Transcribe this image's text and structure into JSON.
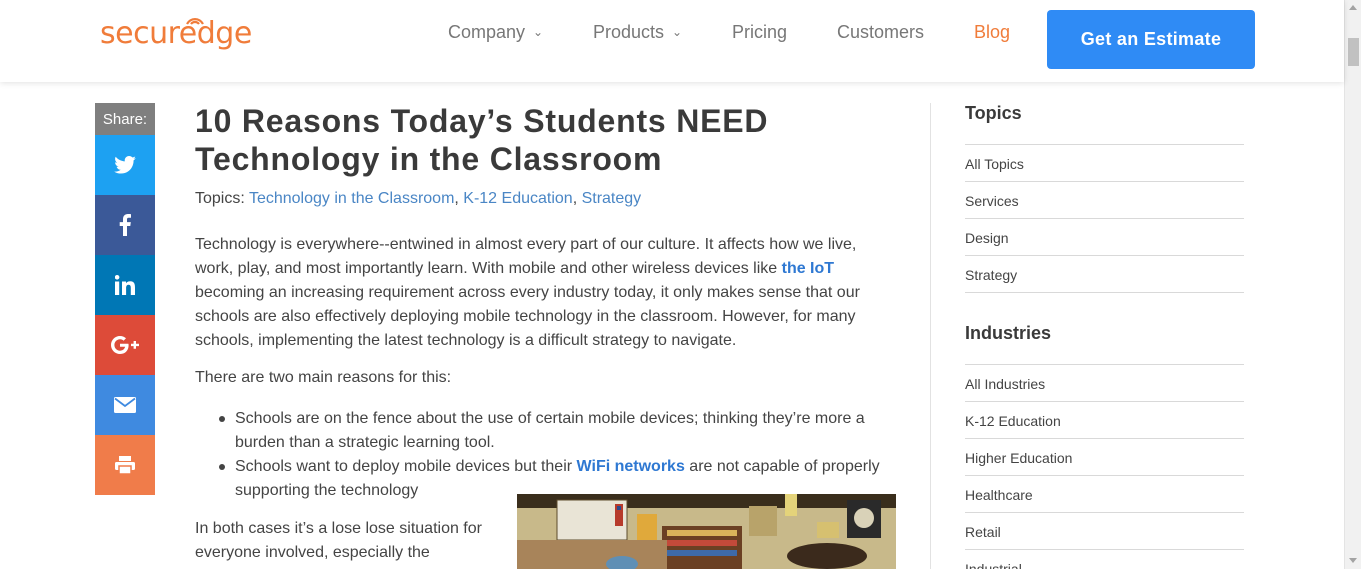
{
  "header": {
    "logo": {
      "prefix": "secur",
      "e": "e",
      "suffix": "dge"
    },
    "nav": [
      {
        "label": "Company",
        "has_dropdown": true
      },
      {
        "label": "Products",
        "has_dropdown": true
      },
      {
        "label": "Pricing",
        "has_dropdown": false
      },
      {
        "label": "Customers",
        "has_dropdown": false
      },
      {
        "label": "Blog",
        "has_dropdown": false,
        "active": true
      }
    ],
    "cta_label": "Get an Estimate"
  },
  "share": {
    "label": "Share:",
    "buttons": [
      {
        "icon": "twitter-icon",
        "color": "#1da1f2"
      },
      {
        "icon": "facebook-icon",
        "color": "#3b5998"
      },
      {
        "icon": "linkedin-icon",
        "color": "#0077b5"
      },
      {
        "icon": "google-plus-icon",
        "color": "#dd4b39"
      },
      {
        "icon": "email-icon",
        "color": "#3f8ae0"
      },
      {
        "icon": "print-icon",
        "color": "#f07c4a"
      }
    ]
  },
  "article": {
    "title_line1": "10 Reasons Today’s Students NEED",
    "title_line2": "Technology in the Classroom",
    "topics_label": "Topics:",
    "topics": [
      "Technology in the Classroom",
      "K-12 Education",
      "Strategy"
    ],
    "p1_a": "Technology is everywhere--entwined in almost every part of our culture. It affects how we live, work, play, and most importantly learn. With mobile and other wireless devices like ",
    "p1_link": "the IoT",
    "p1_b": " becoming an increasing requirement across every industry today, it only makes sense that our schools are also effectively deploying mobile technology in the classroom. However, for many schools, implementing the latest technology is a difficult strategy to navigate.",
    "p2": "There are two main reasons for this:",
    "bullet1": "Schools are on the fence about the use of certain mobile devices; thinking they’re more a burden than a strategic learning tool.",
    "bullet2_a": "Schools want to deploy mobile devices but their ",
    "bullet2_link": "WiFi networks",
    "bullet2_b": " are not capable of properly supporting the technology",
    "p3": "In both cases it’s a lose lose situation for everyone involved, especially the"
  },
  "sidebar": {
    "topics_heading": "Topics",
    "topics": [
      "All Topics",
      "Services",
      "Design",
      "Strategy"
    ],
    "industries_heading": "Industries",
    "industries": [
      "All Industries",
      "K-12 Education",
      "Higher Education",
      "Healthcare",
      "Retail",
      "Industrial"
    ]
  },
  "colors": {
    "brand_orange": "#f07c3a",
    "cta_blue": "#2f8bf5",
    "link_blue": "#4a86c5"
  }
}
